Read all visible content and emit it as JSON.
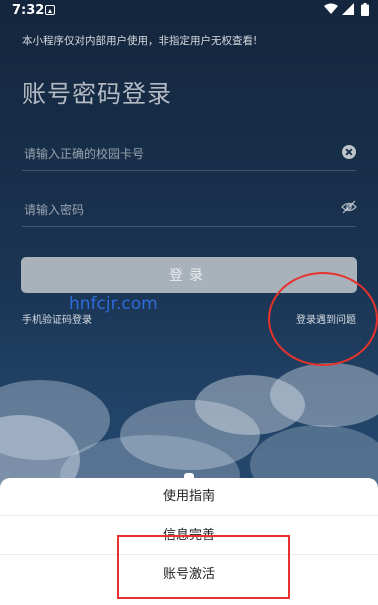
{
  "status_bar": {
    "time": "7:32"
  },
  "notice": "本小程序仅对内部用户使用，非指定用户无权查看!",
  "page_title": "账号密码登录",
  "form": {
    "card_placeholder": "请输入正确的校园卡号",
    "password_placeholder": "请输入密码",
    "login_button": "登录"
  },
  "links": {
    "sms_login": "手机验证码登录",
    "login_problem": "登录遇到问题"
  },
  "watermark": "hnfcjr.com",
  "action_sheet": {
    "items": [
      "使用指南",
      "信息完善",
      "账号激活"
    ]
  },
  "colors": {
    "annotation_red": "#e6322d",
    "watermark_blue": "#2f6bd9",
    "button_disabled": "#a9b2bb"
  }
}
